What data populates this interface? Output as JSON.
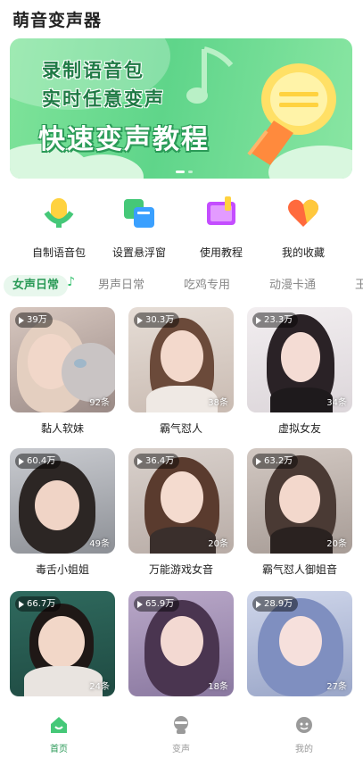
{
  "header": {
    "title": "萌音变声器"
  },
  "banner": {
    "line1": "录制语音包",
    "line2": "实时任意变声",
    "line3": "快速变声教程"
  },
  "quick_actions": [
    {
      "label": "自制语音包",
      "icon": "microphone-icon"
    },
    {
      "label": "设置悬浮窗",
      "icon": "floating-window-icon"
    },
    {
      "label": "使用教程",
      "icon": "tutorial-book-icon"
    },
    {
      "label": "我的收藏",
      "icon": "heart-icon"
    }
  ],
  "tabs": [
    {
      "label": "女声日常",
      "active": true
    },
    {
      "label": "男声日常"
    },
    {
      "label": "吃鸡专用"
    },
    {
      "label": "动漫卡通"
    },
    {
      "label": "王"
    }
  ],
  "cards": [
    {
      "plays": "39万",
      "count": "92条",
      "name": "黏人软妹"
    },
    {
      "plays": "30.3万",
      "count": "38条",
      "name": "霸气怼人"
    },
    {
      "plays": "23.3万",
      "count": "34条",
      "name": "虚拟女友"
    },
    {
      "plays": "60.4万",
      "count": "49条",
      "name": "毒舌小姐姐"
    },
    {
      "plays": "36.4万",
      "count": "20条",
      "name": "万能游戏女音"
    },
    {
      "plays": "63.2万",
      "count": "20条",
      "name": "霸气怼人御姐音"
    },
    {
      "plays": "66.7万",
      "count": "24条",
      "name": ""
    },
    {
      "plays": "65.9万",
      "count": "18条",
      "name": ""
    },
    {
      "plays": "28.9万",
      "count": "27条",
      "name": ""
    }
  ],
  "bottom_nav": [
    {
      "label": "首页",
      "icon": "home-icon",
      "active": true
    },
    {
      "label": "变声",
      "icon": "voice-change-icon"
    },
    {
      "label": "我的",
      "icon": "profile-icon"
    }
  ],
  "colors": {
    "accent": "#2a9a57",
    "banner_green": "#5fd58a"
  }
}
